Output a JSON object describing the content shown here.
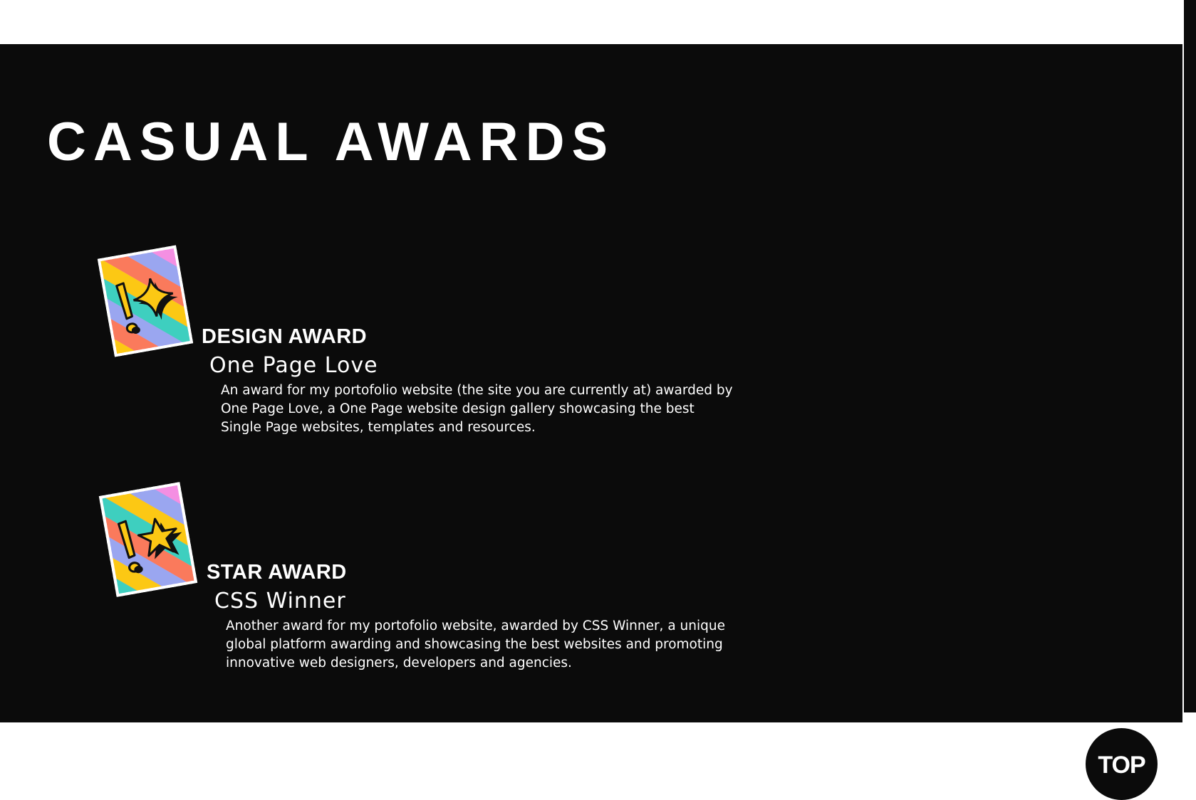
{
  "section": {
    "title": "CASUAL AWARDS"
  },
  "awards": [
    {
      "label": "DESIGN AWARD",
      "organization": "One Page Love",
      "description": "An award for my portofolio website (the site you are currently at) awarded by One Page Love, a One Page website design gallery showcasing the best Single Page websites, templates and resources.",
      "badge_icon": "sparkle-icon"
    },
    {
      "label": "STAR AWARD",
      "organization": "CSS Winner",
      "description": "Another award for my portofolio website, awarded by CSS Winner, a unique global platform awarding and showcasing the best websites and promoting innovative web designers, developers and agencies.",
      "badge_icon": "star-icon"
    }
  ],
  "top_button": {
    "label": "TOP"
  },
  "colors": {
    "background": "#0b0b0b",
    "text": "#ffffff",
    "stripe_pink": "#f48fe2",
    "stripe_orange": "#fa7a5c",
    "stripe_yellow": "#fcc814",
    "stripe_teal": "#3ecfbf",
    "stripe_blue": "#9aa6f0"
  }
}
